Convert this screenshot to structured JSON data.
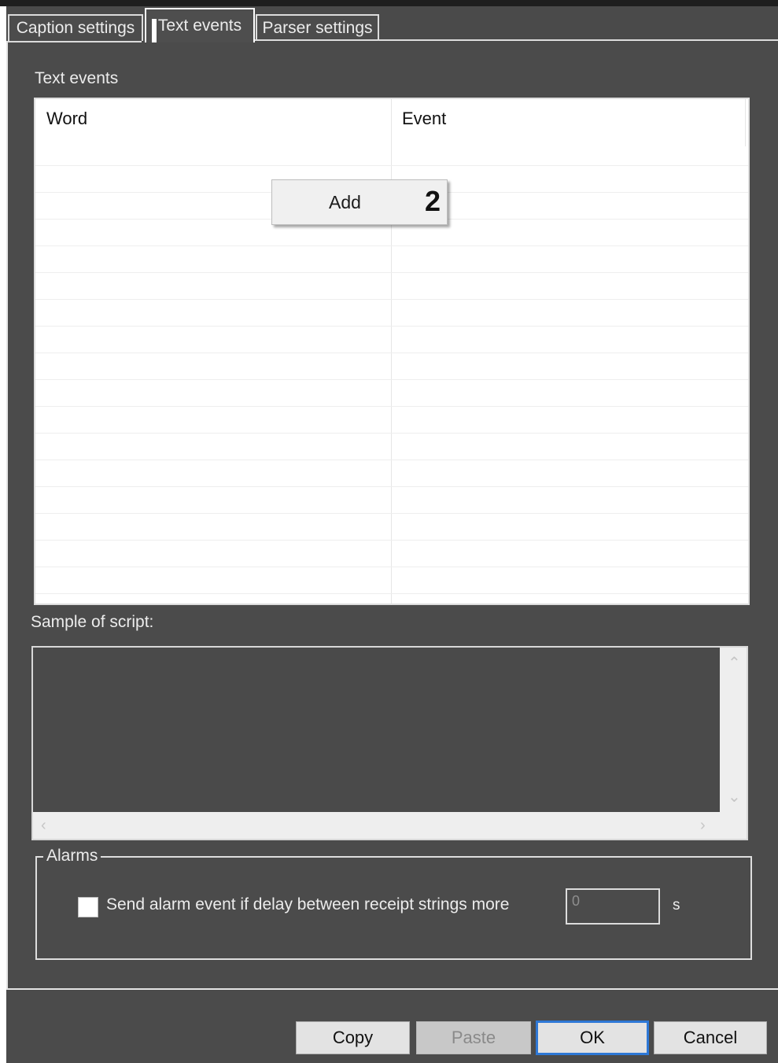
{
  "tabs": {
    "caption_settings": "Caption settings",
    "text_events": "Text events",
    "parser_settings": "Parser settings"
  },
  "markers": {
    "tab_marker": "1",
    "menu_marker": "2"
  },
  "text_events": {
    "section_label": "Text events",
    "columns": {
      "word": "Word",
      "event": "Event"
    },
    "rows": []
  },
  "context_menu": {
    "items": [
      "Add"
    ]
  },
  "script": {
    "label": "Sample of script:",
    "value": ""
  },
  "alarms": {
    "group_title": "Alarms",
    "checkbox_label": "Send alarm event if delay between receipt strings more",
    "checked": false,
    "delay_value": "0",
    "unit": "s"
  },
  "buttons": {
    "copy": "Copy",
    "paste": "Paste",
    "ok": "OK",
    "cancel": "Cancel"
  },
  "colors": {
    "panel_bg": "#4b4b4b",
    "grid_bg": "#ffffff",
    "focus_border": "#2e78d6",
    "button_bg": "#e3e3e3"
  }
}
